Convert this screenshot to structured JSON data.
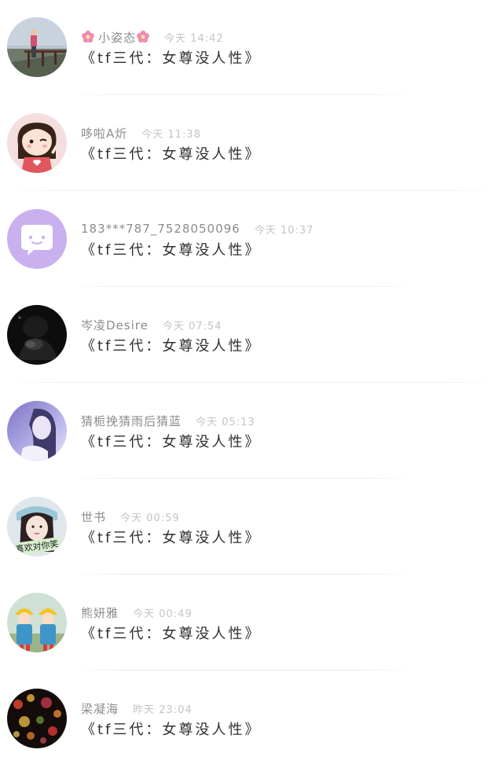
{
  "comments": [
    {
      "name": "小姿态",
      "time": "今天 14:42",
      "message": "《tf三代：女尊没人性》",
      "icon": "pink-flower-icon"
    },
    {
      "name": "哆啦A炘",
      "time": "今天 11:38",
      "message": "《tf三代：女尊没人性》"
    },
    {
      "name": "183***787_7528050096",
      "time": "今天 10:37",
      "message": "《tf三代：女尊没人性》",
      "icon": "speech-bubble-icon"
    },
    {
      "name": "岑凌Desire",
      "time": "今天 07:54",
      "message": "《tf三代：女尊没人性》"
    },
    {
      "name": "猜栀挽猜雨后猜蓝",
      "time": "今天 05:13",
      "message": "《tf三代：女尊没人性》"
    },
    {
      "name": "世书",
      "time": "今天 00:59",
      "message": "《tf三代：女尊没人性》",
      "avatar_text": "喜欢对你笑"
    },
    {
      "name": "熊妍雅",
      "time": "今天 00:49",
      "message": "《tf三代：女尊没人性》"
    },
    {
      "name": "梁凝海",
      "time": "昨天 23:04",
      "message": "《tf三代：女尊没人性》"
    }
  ],
  "colors": {
    "name": "#8c8c8c",
    "time": "#c4c4c4",
    "message": "#2f2f2f",
    "avatar_purple": "#c9b0ef",
    "flower_pink": "#f08cb0"
  }
}
